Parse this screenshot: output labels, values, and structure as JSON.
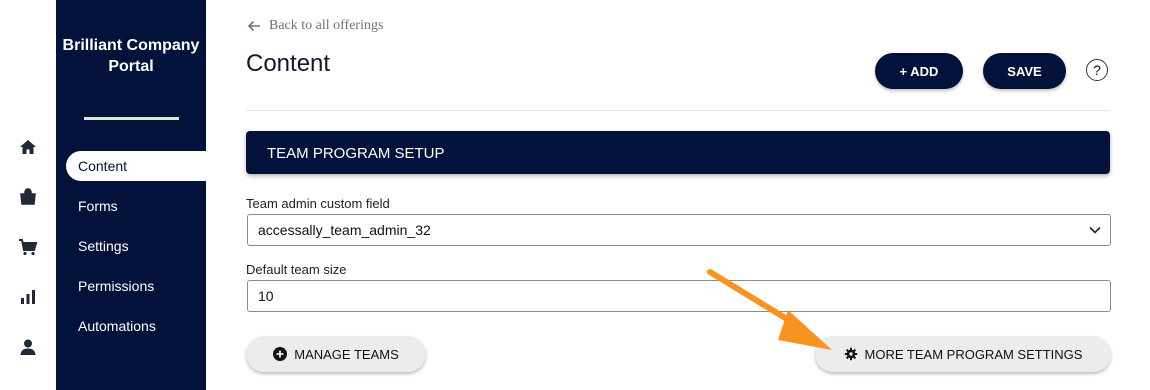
{
  "sidebar": {
    "brand": "Brilliant Company Portal",
    "items": [
      {
        "label": "Content",
        "active": true
      },
      {
        "label": "Forms"
      },
      {
        "label": "Settings"
      },
      {
        "label": "Permissions"
      },
      {
        "label": "Automations"
      }
    ]
  },
  "rail_icons": [
    "home-icon",
    "store-icon",
    "cart-icon",
    "bar-chart-icon",
    "user-icon"
  ],
  "header": {
    "back_label": "Back to all offerings",
    "title": "Content",
    "add_label": "+ ADD",
    "save_label": "SAVE",
    "help_label": "?"
  },
  "section": {
    "title": "TEAM PROGRAM SETUP"
  },
  "fields": {
    "team_admin": {
      "label": "Team admin custom field",
      "value": "accessally_team_admin_32"
    },
    "team_size": {
      "label": "Default team size",
      "value": "10"
    }
  },
  "buttons": {
    "manage_teams": "MANAGE TEAMS",
    "more_settings": "MORE TEAM PROGRAM SETTINGS"
  },
  "colors": {
    "navy": "#03123b",
    "highlight_arrow": "#f7931e"
  }
}
